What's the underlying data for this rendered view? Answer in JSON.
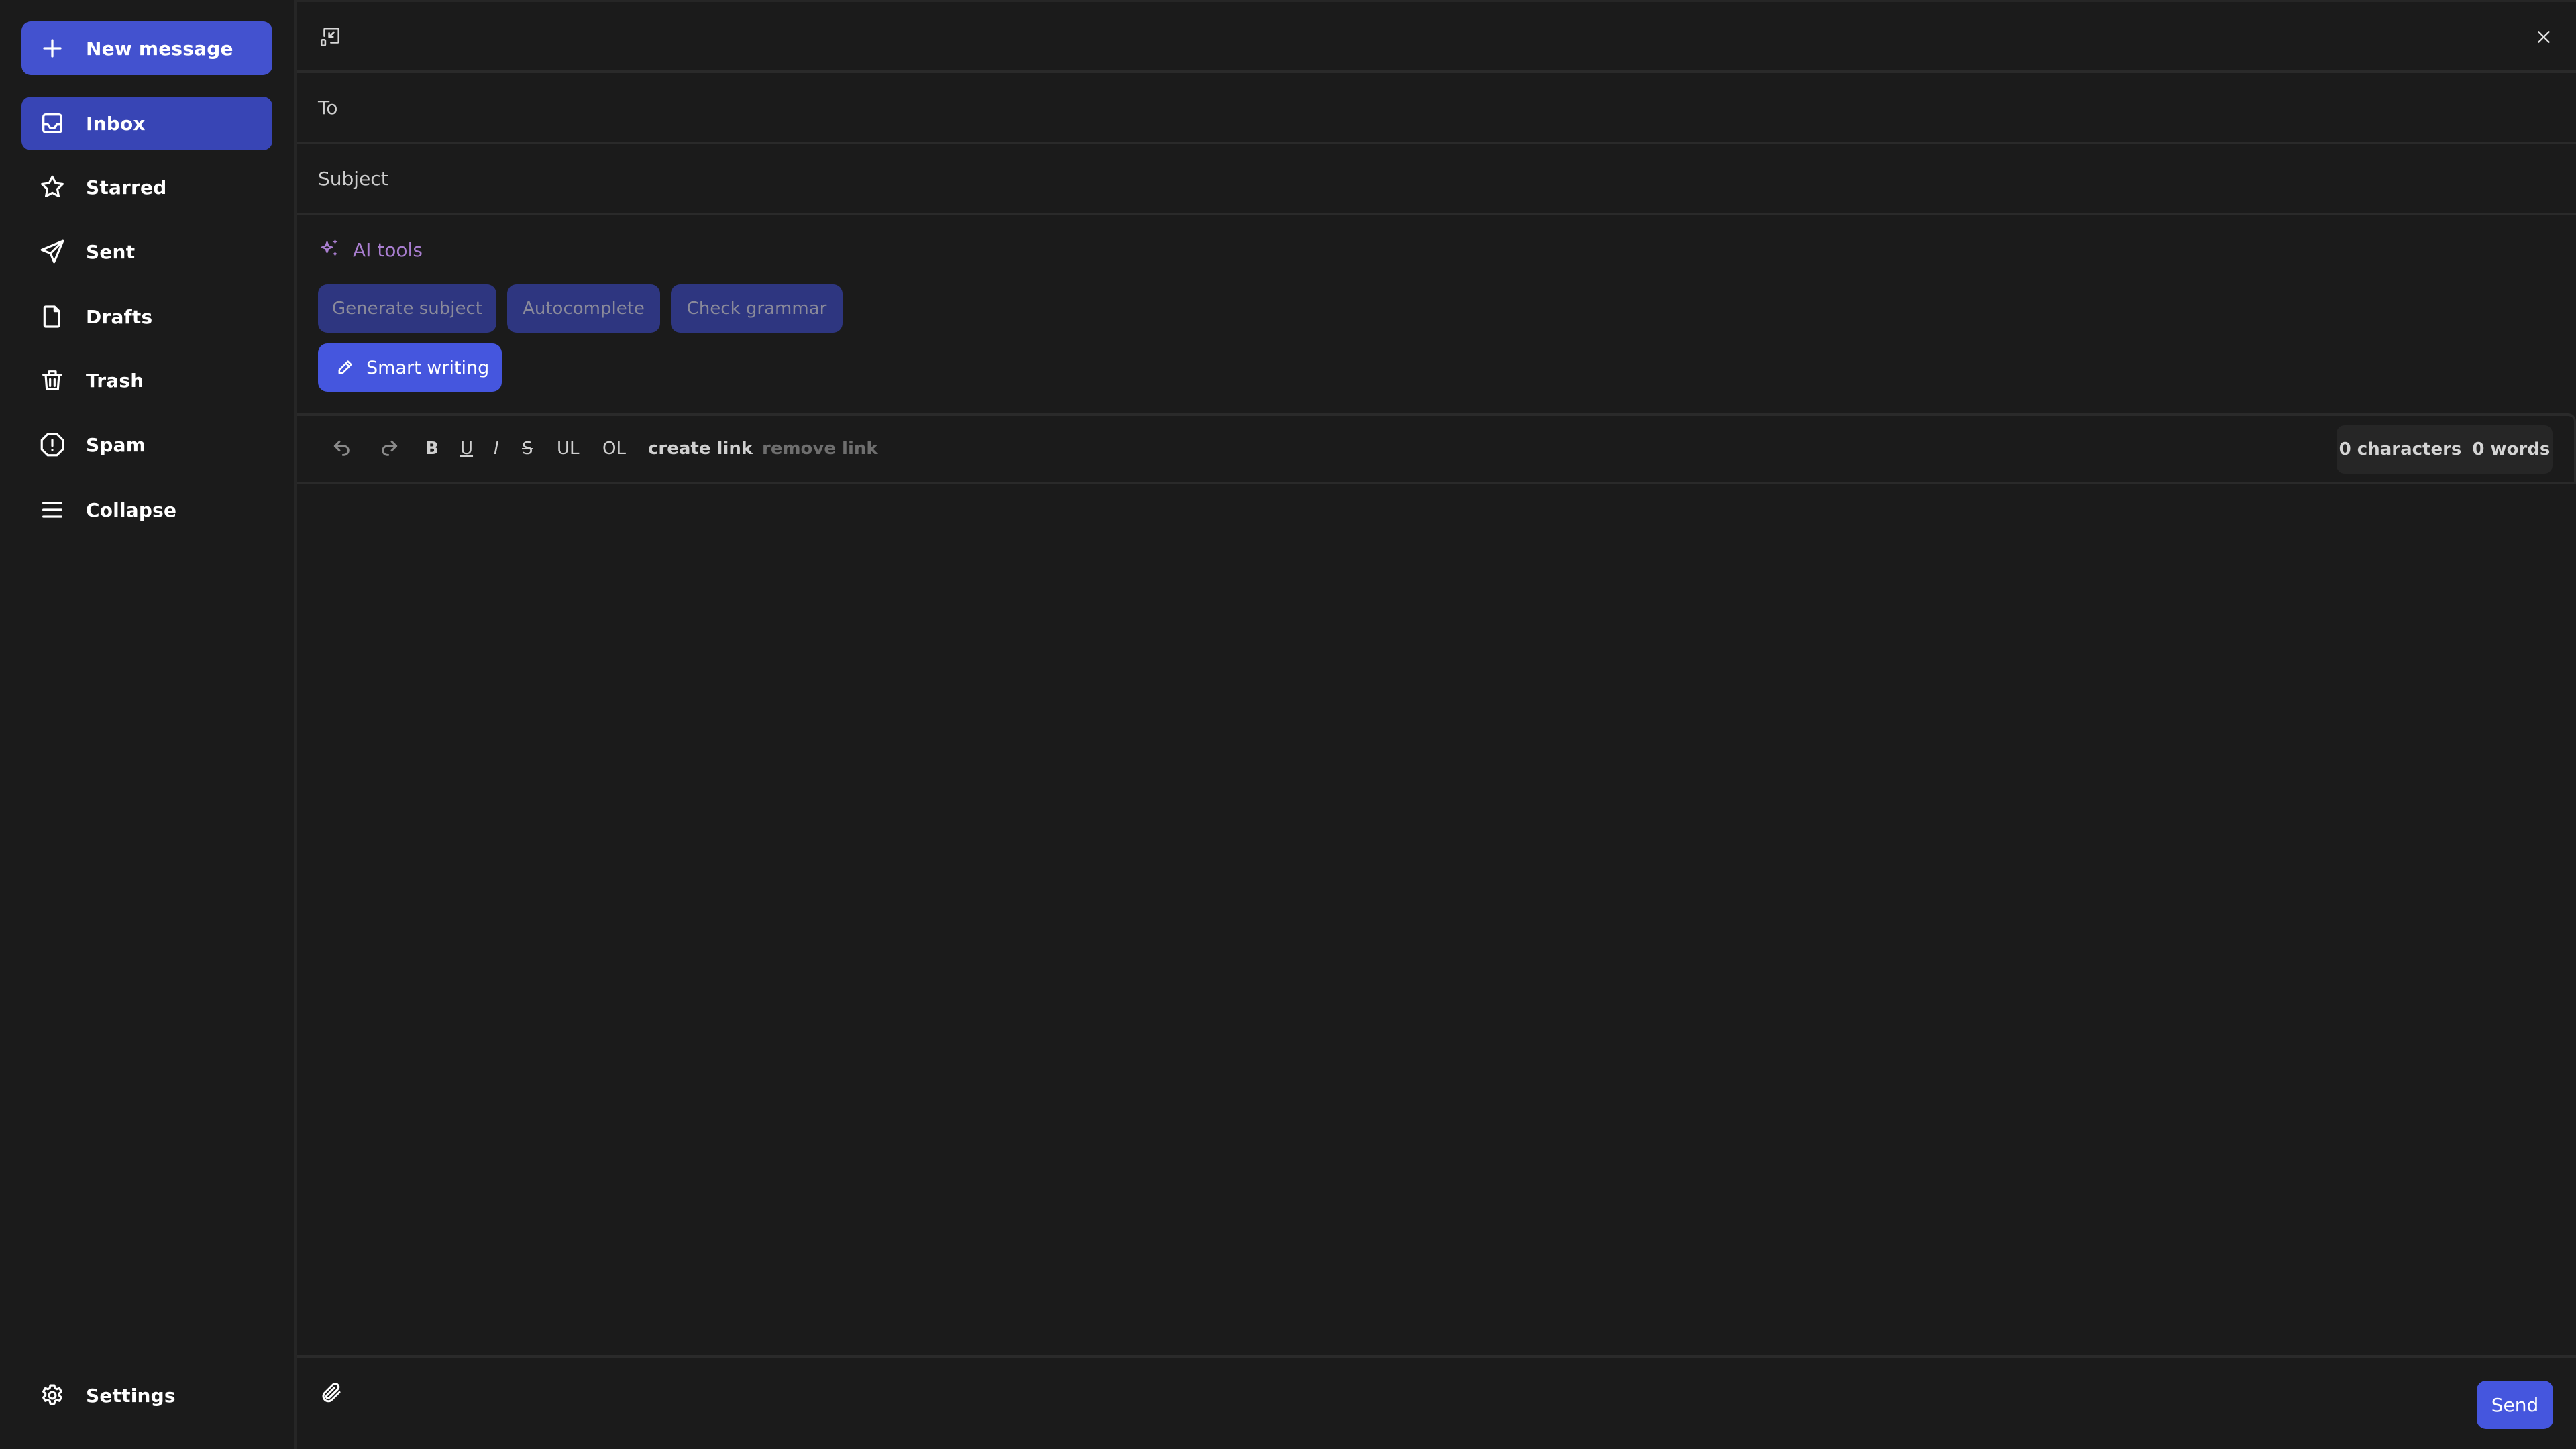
{
  "sidebar": {
    "new_message": {
      "label": "New message",
      "icon": "plus-icon"
    },
    "items": [
      {
        "label": "Inbox",
        "icon": "inbox-icon",
        "active": true
      },
      {
        "label": "Starred",
        "icon": "star-icon",
        "active": false
      },
      {
        "label": "Sent",
        "icon": "send-icon",
        "active": false
      },
      {
        "label": "Drafts",
        "icon": "file-icon",
        "active": false
      },
      {
        "label": "Trash",
        "icon": "trash-icon",
        "active": false
      },
      {
        "label": "Spam",
        "icon": "alert-octagon-icon",
        "active": false
      },
      {
        "label": "Collapse",
        "icon": "menu-icon",
        "active": false
      }
    ],
    "settings": {
      "label": "Settings",
      "icon": "gear-icon"
    }
  },
  "compose": {
    "header": {
      "minimize_icon": "minimize-icon",
      "close_icon": "close-icon"
    },
    "to": {
      "label": "To",
      "value": ""
    },
    "subject": {
      "label": "Subject",
      "value": ""
    },
    "ai_tools": {
      "label": "AI tools",
      "icon": "sparkles-icon",
      "buttons": [
        "Generate subject",
        "Autocomplete",
        "Check grammar"
      ],
      "smart_writing": "Smart writing"
    },
    "toolbar": {
      "undo": "undo-icon",
      "redo": "redo-icon",
      "bold": "B",
      "underline": "U",
      "italic": "I",
      "strike": "S",
      "ul": "UL",
      "ol": "OL",
      "create_link": "create link",
      "remove_link": "remove link",
      "characters": "0 characters",
      "words": "0 words"
    },
    "body": "",
    "footer": {
      "attach_icon": "paperclip-icon",
      "send": "Send"
    }
  },
  "colors": {
    "accent": "#4556de",
    "active_nav": "#3845b5",
    "ai_button": "#2e3680",
    "ai_label": "#a97ed0",
    "background": "#1b1b1b"
  }
}
